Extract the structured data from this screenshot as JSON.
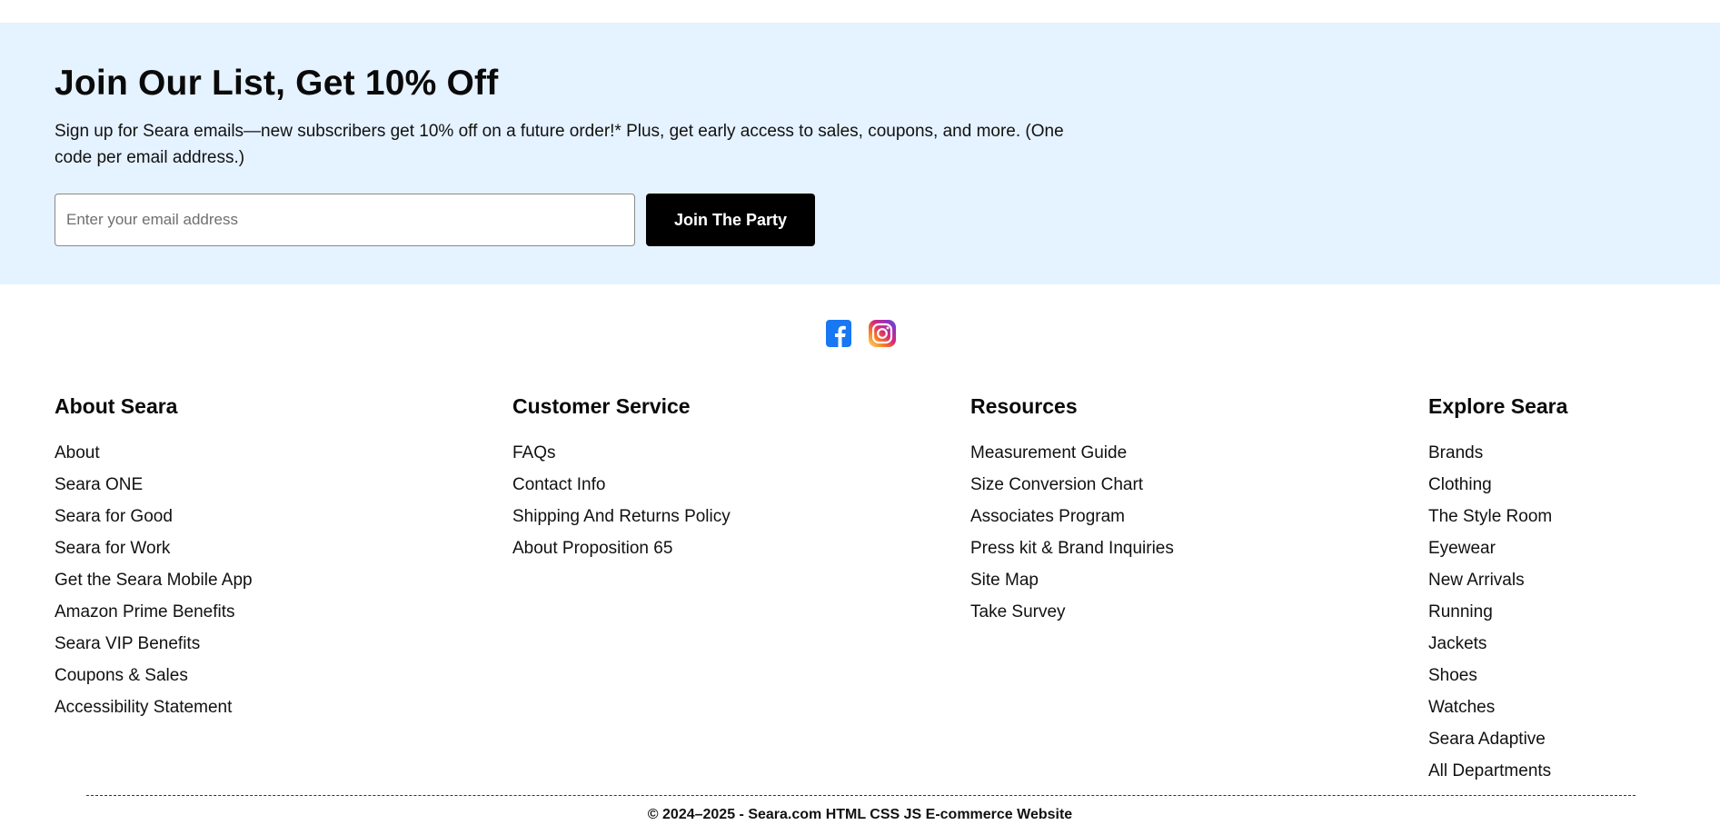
{
  "signup": {
    "title": "Join Our List, Get 10% Off",
    "description": "Sign up for Seara emails—new subscribers get 10% off on a future order!* Plus, get early access to sales, coupons, and more. (One code per email address.)",
    "email_value": "",
    "email_placeholder": "Enter your email address",
    "button_label": "Join The Party",
    "background_color": "#e5f2ff",
    "button_color": "#000000"
  },
  "social": [
    {
      "icon": "facebook-icon",
      "color": "#1877f2"
    },
    {
      "icon": "instagram-icon",
      "color": "#e1306c"
    }
  ],
  "footer": {
    "columns": [
      {
        "heading": "About Seara",
        "links": [
          "About",
          "Seara ONE",
          "Seara for Good",
          "Seara for Work",
          "Get the Seara Mobile App",
          "Amazon Prime Benefits",
          "Seara VIP Benefits",
          "Coupons & Sales",
          "Accessibility Statement"
        ]
      },
      {
        "heading": "Customer Service",
        "links": [
          "FAQs",
          "Contact Info",
          "Shipping And Returns Policy",
          "About Proposition 65"
        ]
      },
      {
        "heading": "Resources",
        "links": [
          "Measurement Guide",
          "Size Conversion Chart",
          "Associates Program",
          "Press kit & Brand Inquiries",
          "Site Map",
          "Take Survey"
        ]
      },
      {
        "heading": "Explore Seara",
        "links": [
          "Brands",
          "Clothing",
          "The Style Room",
          "Eyewear",
          "New Arrivals",
          "Running",
          "Jackets",
          "Shoes",
          "Watches",
          "Seara Adaptive",
          "All Departments"
        ]
      }
    ],
    "copyright": "© 2024–2025 - Seara.com HTML CSS JS E-commerce Website"
  }
}
